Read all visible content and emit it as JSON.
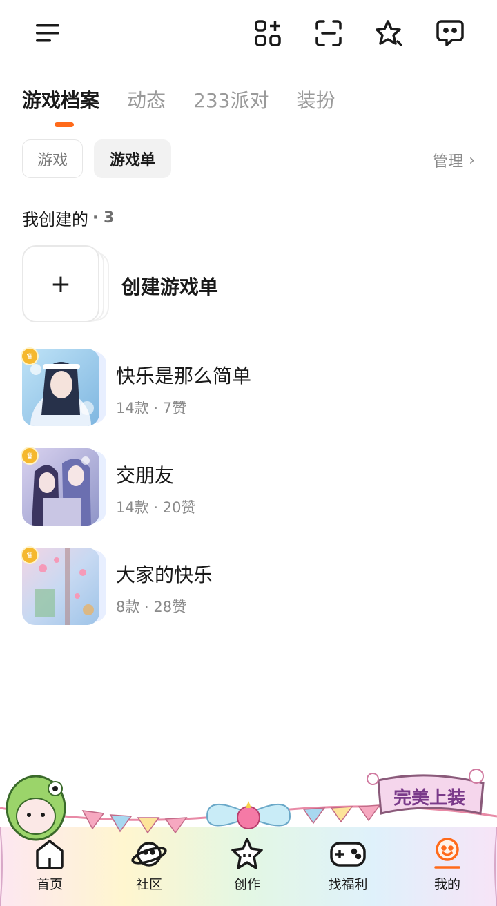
{
  "topbar": {
    "icons": [
      "menu-icon",
      "apps-add-icon",
      "scan-icon",
      "star-sparkle-icon",
      "message-icon"
    ]
  },
  "tabs": [
    {
      "label": "游戏档案",
      "active": true
    },
    {
      "label": "动态",
      "active": false
    },
    {
      "label": "233派对",
      "active": false
    },
    {
      "label": "装扮",
      "active": false
    }
  ],
  "filters": {
    "game_label": "游戏",
    "list_label": "游戏单",
    "manage_label": "管理",
    "selected": "游戏单"
  },
  "section": {
    "title": "我创建的",
    "count_text": "· 3"
  },
  "create": {
    "plus": "+",
    "label": "创建游戏单"
  },
  "lists": [
    {
      "title": "快乐是那么简单",
      "meta": "14款 · 7赞"
    },
    {
      "title": "交朋友",
      "meta": "14款 · 20赞"
    },
    {
      "title": "大家的快乐",
      "meta": "8款 · 28赞"
    }
  ],
  "decoration": {
    "banner_text": "完美上装"
  },
  "bottom_nav": [
    {
      "label": "首页",
      "icon": "home-icon",
      "active": false
    },
    {
      "label": "社区",
      "icon": "planet-icon",
      "active": false
    },
    {
      "label": "创作",
      "icon": "star-create-icon",
      "active": false
    },
    {
      "label": "找福利",
      "icon": "gamepad-icon",
      "active": false
    },
    {
      "label": "我的",
      "icon": "profile-icon",
      "active": true
    }
  ],
  "colors": {
    "accent": "#ff6a1a",
    "text": "#1a1a1a",
    "muted": "#8a8a8a"
  }
}
